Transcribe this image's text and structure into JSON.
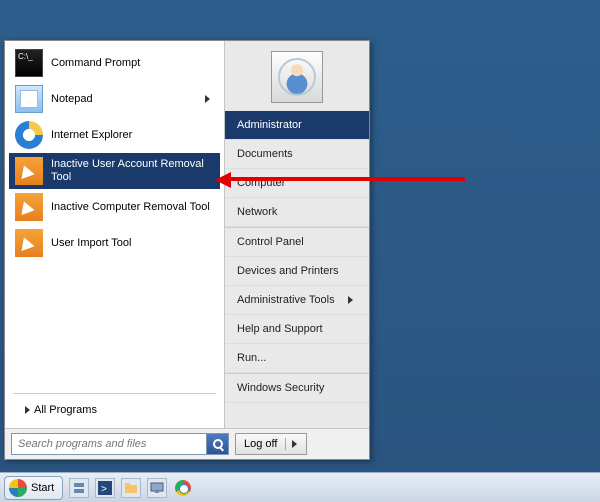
{
  "left_apps": [
    {
      "label": "Command Prompt",
      "icon": "cmd",
      "has_submenu": false,
      "selected": false
    },
    {
      "label": "Notepad",
      "icon": "notepad",
      "has_submenu": true,
      "selected": false
    },
    {
      "label": "Internet Explorer",
      "icon": "ie",
      "has_submenu": false,
      "selected": false
    },
    {
      "label": "Inactive User Account Removal Tool",
      "icon": "orange",
      "has_submenu": false,
      "selected": true
    },
    {
      "label": "Inactive Computer Removal Tool",
      "icon": "orange",
      "has_submenu": false,
      "selected": false
    },
    {
      "label": "User Import Tool",
      "icon": "orange",
      "has_submenu": false,
      "selected": false
    }
  ],
  "all_programs_label": "All Programs",
  "right_items_top": [
    {
      "label": "Administrator",
      "selected": true,
      "has_submenu": false
    },
    {
      "label": "Documents",
      "selected": false,
      "has_submenu": false
    },
    {
      "label": "Computer",
      "selected": false,
      "has_submenu": false
    },
    {
      "label": "Network",
      "selected": false,
      "has_submenu": false
    }
  ],
  "right_items_bottom": [
    {
      "label": "Control Panel",
      "selected": false,
      "has_submenu": false
    },
    {
      "label": "Devices and Printers",
      "selected": false,
      "has_submenu": false
    },
    {
      "label": "Administrative Tools",
      "selected": false,
      "has_submenu": true
    },
    {
      "label": "Help and Support",
      "selected": false,
      "has_submenu": false
    },
    {
      "label": "Run...",
      "selected": false,
      "has_submenu": false
    }
  ],
  "right_items_security": [
    {
      "label": "Windows Security",
      "selected": false,
      "has_submenu": false
    }
  ],
  "search": {
    "placeholder": "Search programs and files"
  },
  "logoff_label": "Log off",
  "taskbar": {
    "start_label": "Start"
  }
}
